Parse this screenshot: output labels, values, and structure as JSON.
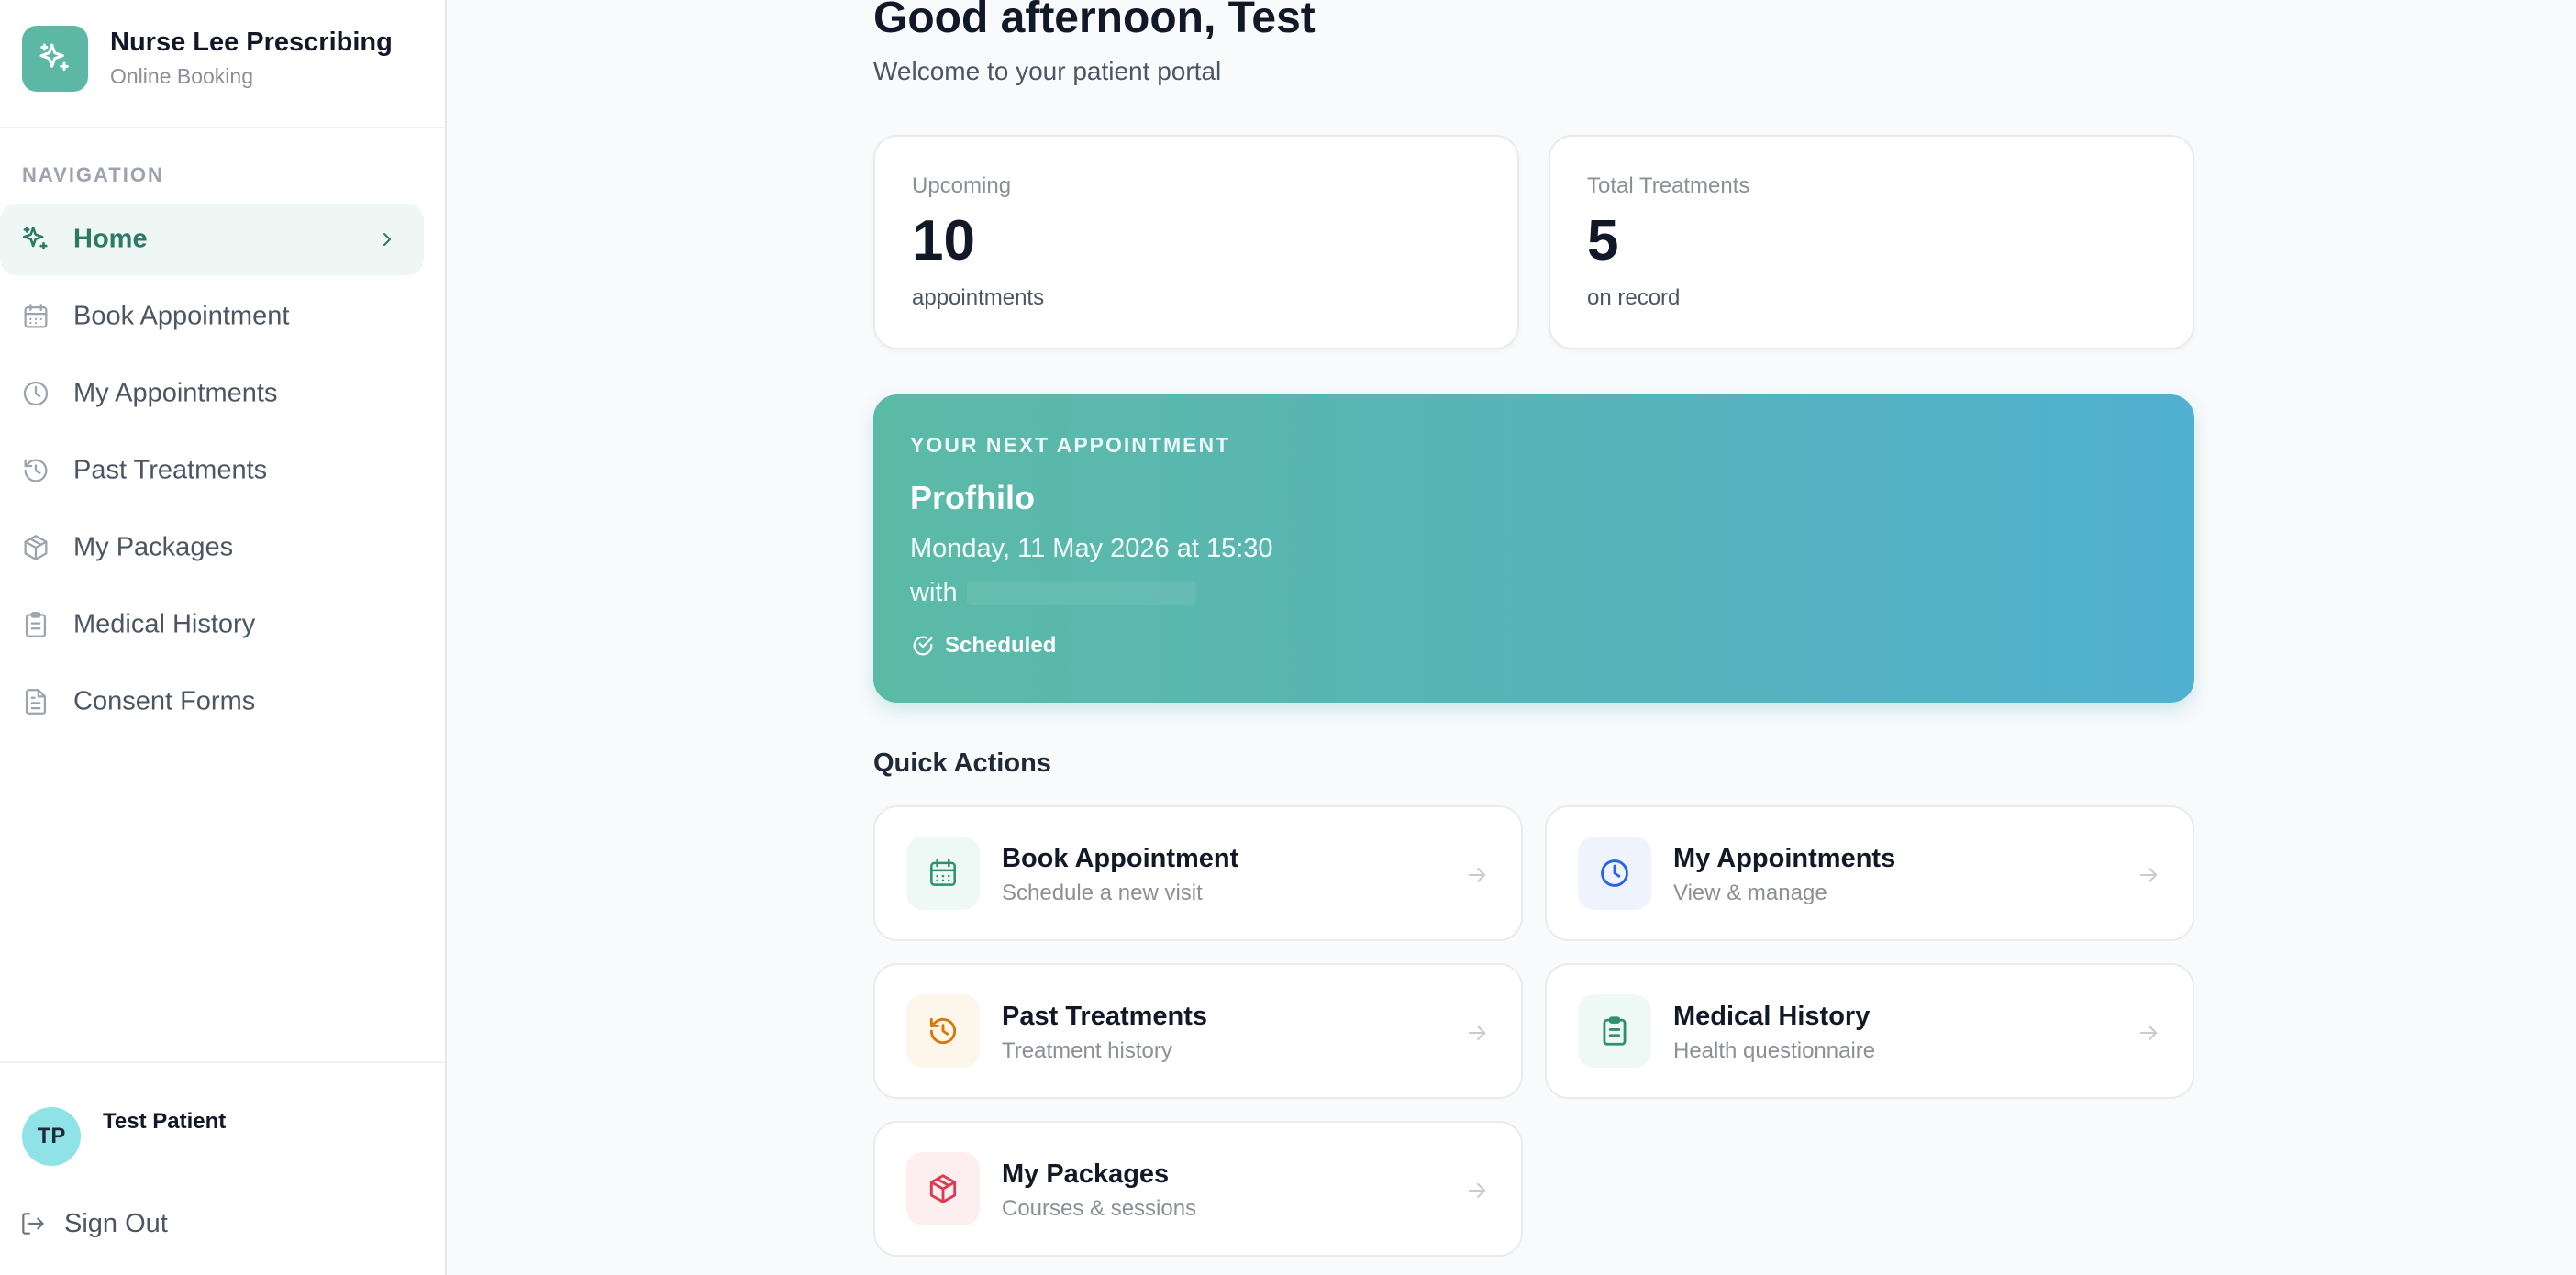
{
  "brand": {
    "title": "Nurse Lee Prescribing",
    "subtitle": "Online Booking",
    "accent": "#5cb8a5"
  },
  "nav": {
    "heading": "NAVIGATION",
    "items": [
      {
        "label": "Home",
        "icon": "sparkles-icon",
        "active": true
      },
      {
        "label": "Book Appointment",
        "icon": "calendar-icon"
      },
      {
        "label": "My Appointments",
        "icon": "clock-icon"
      },
      {
        "label": "Past Treatments",
        "icon": "history-icon"
      },
      {
        "label": "My Packages",
        "icon": "package-icon"
      },
      {
        "label": "Medical History",
        "icon": "clipboard-icon"
      },
      {
        "label": "Consent Forms",
        "icon": "file-text-icon"
      }
    ]
  },
  "user": {
    "initials": "TP",
    "name": "Test Patient",
    "sign_out": "Sign Out"
  },
  "header": {
    "greeting": "Good afternoon, Test",
    "welcome": "Welcome to your patient portal"
  },
  "stats": [
    {
      "label": "Upcoming",
      "value": "10",
      "sub": "appointments"
    },
    {
      "label": "Total Treatments",
      "value": "5",
      "sub": "on record"
    }
  ],
  "next_appointment": {
    "eyebrow": "YOUR NEXT APPOINTMENT",
    "title": "Profhilo",
    "when": "Monday, 11 May 2026 at 15:30",
    "with_prefix": "with",
    "status": "Scheduled"
  },
  "quick_actions": {
    "heading": "Quick Actions",
    "items": [
      {
        "title": "Book Appointment",
        "sub": "Schedule a new visit",
        "icon": "calendar-icon",
        "color": "#2f8f6f",
        "bg": "#eef8f4"
      },
      {
        "title": "My Appointments",
        "sub": "View & manage",
        "icon": "clock-icon",
        "color": "#2563eb",
        "bg": "#eef3fd"
      },
      {
        "title": "Past Treatments",
        "sub": "Treatment history",
        "icon": "history-icon",
        "color": "#d97706",
        "bg": "#fdf6ea"
      },
      {
        "title": "Medical History",
        "sub": "Health questionnaire",
        "icon": "clipboard-icon",
        "color": "#2f8f6f",
        "bg": "#eef8f4"
      },
      {
        "title": "My Packages",
        "sub": "Courses & sessions",
        "icon": "package-icon",
        "color": "#dc3b4f",
        "bg": "#fdeef0"
      }
    ]
  }
}
